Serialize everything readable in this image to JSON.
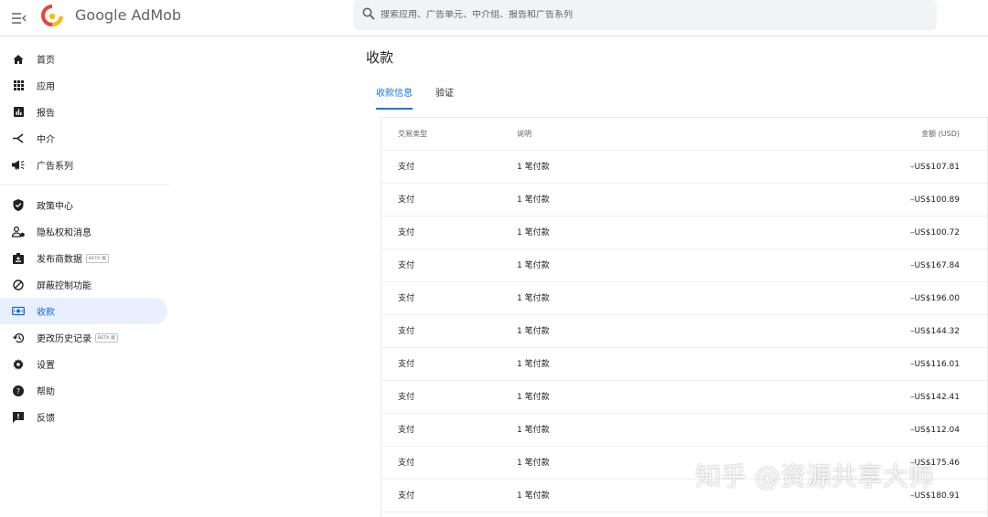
{
  "app": {
    "brand": "Google AdMob"
  },
  "search": {
    "placeholder": "搜索应用、广告单元、中介组、报告和广告系列"
  },
  "sidebar": {
    "items": [
      {
        "label": "首页",
        "icon": "home-icon"
      },
      {
        "label": "应用",
        "icon": "apps-grid-icon"
      },
      {
        "label": "报告",
        "icon": "bar-chart-icon"
      },
      {
        "label": "中介",
        "icon": "mediation-icon"
      },
      {
        "label": "广告系列",
        "icon": "campaign-megaphone-icon"
      },
      {
        "label": "政策中心",
        "icon": "shield-check-icon"
      },
      {
        "label": "隐私权和消息",
        "icon": "privacy-person-icon"
      },
      {
        "label": "发布商数据",
        "icon": "publisher-data-icon",
        "badge": "BETA 版"
      },
      {
        "label": "屏蔽控制功能",
        "icon": "block-icon"
      },
      {
        "label": "收款",
        "icon": "payments-icon",
        "active": true
      },
      {
        "label": "更改历史记录",
        "icon": "history-icon",
        "badge": "BETA 版"
      },
      {
        "label": "设置",
        "icon": "gear-icon"
      },
      {
        "label": "帮助",
        "icon": "help-icon"
      },
      {
        "label": "反馈",
        "icon": "feedback-icon"
      }
    ]
  },
  "page": {
    "title": "收款",
    "tabs": [
      {
        "label": "收款信息",
        "active": true
      },
      {
        "label": "验证",
        "active": false
      }
    ]
  },
  "table": {
    "columns": [
      "交易类型",
      "说明",
      "金额 (USD)"
    ],
    "rows": [
      {
        "type": "支付",
        "desc": "1 笔付款",
        "amount": "–US$107.81"
      },
      {
        "type": "支付",
        "desc": "1 笔付款",
        "amount": "–US$100.89"
      },
      {
        "type": "支付",
        "desc": "1 笔付款",
        "amount": "–US$100.72"
      },
      {
        "type": "支付",
        "desc": "1 笔付款",
        "amount": "–US$167.84"
      },
      {
        "type": "支付",
        "desc": "1 笔付款",
        "amount": "–US$196.00"
      },
      {
        "type": "支付",
        "desc": "1 笔付款",
        "amount": "–US$144.32"
      },
      {
        "type": "支付",
        "desc": "1 笔付款",
        "amount": "–US$116.01"
      },
      {
        "type": "支付",
        "desc": "1 笔付款",
        "amount": "–US$142.41"
      },
      {
        "type": "支付",
        "desc": "1 笔付款",
        "amount": "–US$112.04"
      },
      {
        "type": "支付",
        "desc": "1 笔付款",
        "amount": "–US$175.46"
      },
      {
        "type": "支付",
        "desc": "1 笔付款",
        "amount": "–US$180.91"
      }
    ]
  },
  "watermark": "知乎 @资源共享大师",
  "colors": {
    "accent": "#1a73e8",
    "active_bg": "#e8f0fe"
  }
}
